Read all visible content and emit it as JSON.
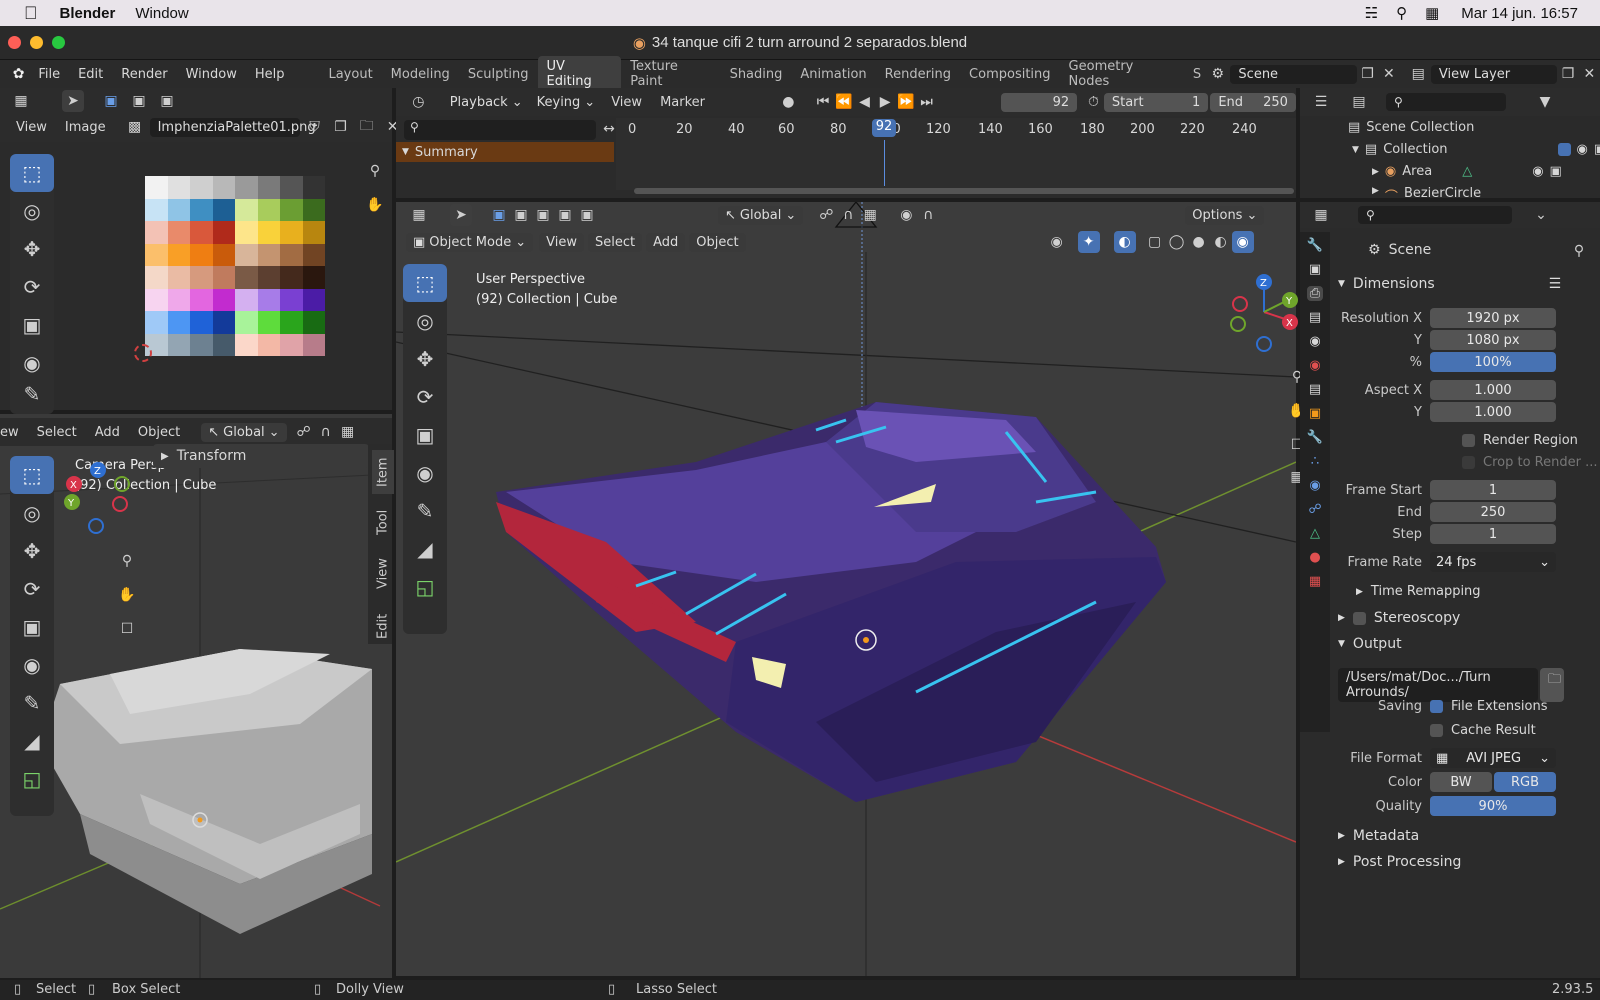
{
  "menubar": {
    "app": "Blender",
    "window_menu": "Window",
    "datetime": "Mar 14 jun.  16:57"
  },
  "window": {
    "title": "34 tanque cifi 2 turn arround 2 separados.blend"
  },
  "topbar": {
    "menus": [
      "File",
      "Edit",
      "Render",
      "Window",
      "Help"
    ],
    "workspaces": [
      "Layout",
      "Modeling",
      "Sculpting",
      "UV Editing",
      "Texture Paint",
      "Shading",
      "Animation",
      "Rendering",
      "Compositing",
      "Geometry Nodes",
      "S"
    ],
    "active_workspace": "UV Editing",
    "scene": "Scene",
    "view_layer": "View Layer"
  },
  "image_editor": {
    "view": "View",
    "image": "Image",
    "image_name": "ImphenziaPalette01.png",
    "palette": [
      "#f2f2f2",
      "#e0e0e0",
      "#cfcfcf",
      "#b8b8b8",
      "#9a9a9a",
      "#7a7a7a",
      "#555555",
      "#333333",
      "#c7e3f5",
      "#8fc4e6",
      "#3f8fc2",
      "#1d5f94",
      "#d5e99a",
      "#a8cc5c",
      "#6b9e33",
      "#3b6b1e",
      "#f3c2b5",
      "#e98a6a",
      "#d9583b",
      "#b02a1b",
      "#fde58a",
      "#f9d23a",
      "#e8b01e",
      "#b8860f",
      "#fbbf6b",
      "#f99f26",
      "#ef7e12",
      "#c95b0b",
      "#d8b59a",
      "#c49470",
      "#a26c43",
      "#714423",
      "#f4d8c8",
      "#eabba4",
      "#d69a7e",
      "#c07b5e",
      "#7a5a46",
      "#5c3f30",
      "#44291c",
      "#2a170e",
      "#f7d4f0",
      "#efa8ea",
      "#e366e0",
      "#c22bcf",
      "#d4b0f0",
      "#a77ce8",
      "#7a40d2",
      "#4b1ca6",
      "#9fc9f7",
      "#4d96f3",
      "#1f62d8",
      "#133a9a",
      "#a8f39a",
      "#5edc3c",
      "#2aa51c",
      "#186b13",
      "#b9c8d3",
      "#93a5b3",
      "#6d8191",
      "#465a6a",
      "#fbd7c9",
      "#f3b8a6",
      "#e0a3a8",
      "#b77c8a"
    ]
  },
  "timeline": {
    "playback": "Playback",
    "keying": "Keying",
    "view": "View",
    "marker": "Marker",
    "current_frame": "92",
    "start_label": "Start",
    "start": "1",
    "end_label": "End",
    "end": "250",
    "ruler": [
      "0",
      "20",
      "40",
      "60",
      "80",
      "100",
      "120",
      "140",
      "160",
      "180",
      "200",
      "220",
      "240"
    ],
    "playhead": "92",
    "summary": "Summary"
  },
  "viewport": {
    "mode": "Object Mode",
    "menus": [
      "View",
      "Select",
      "Add",
      "Object"
    ],
    "orientation": "Global",
    "options": "Options",
    "perspective": "User Perspective",
    "context": "(92) Collection | Cube"
  },
  "left_viewport": {
    "menus": [
      "ew",
      "Select",
      "Add",
      "Object"
    ],
    "orientation": "Global",
    "perspective": "Camera Persp",
    "context": "(92) Collection | Cube",
    "transform": "Transform",
    "tabs": [
      "Item",
      "Tool",
      "View",
      "Edit"
    ]
  },
  "outliner": {
    "root": "Scene Collection",
    "collection": "Collection",
    "items": [
      "Area",
      "BezierCircle"
    ]
  },
  "properties": {
    "scene": "Scene",
    "dimensions": "Dimensions",
    "resolution_x_label": "Resolution X",
    "resolution_x": "1920 px",
    "y_label": "Y",
    "resolution_y": "1080 px",
    "pct_label": "%",
    "resolution_pct": "100%",
    "aspect_x_label": "Aspect X",
    "aspect_x": "1.000",
    "aspect_y": "1.000",
    "render_region": "Render Region",
    "crop": "Crop to Render ...",
    "frame_start_label": "Frame Start",
    "frame_start": "1",
    "end_label": "End",
    "frame_end": "250",
    "step_label": "Step",
    "step": "1",
    "frame_rate_label": "Frame Rate",
    "frame_rate": "24 fps",
    "time_remapping": "Time Remapping",
    "stereoscopy": "Stereoscopy",
    "output": "Output",
    "output_path": "/Users/mat/Doc.../Turn Arrounds/",
    "saving_label": "Saving",
    "file_extensions": "File Extensions",
    "cache_result": "Cache Result",
    "file_format_label": "File Format",
    "file_format": "AVI JPEG",
    "color_label": "Color",
    "bw": "BW",
    "rgb": "RGB",
    "quality_label": "Quality",
    "quality": "90%",
    "metadata": "Metadata",
    "post_processing": "Post Processing"
  },
  "statusbar": {
    "select": "Select",
    "box_select": "Box Select",
    "dolly": "Dolly View",
    "lasso": "Lasso Select",
    "version": "2.93.5"
  }
}
